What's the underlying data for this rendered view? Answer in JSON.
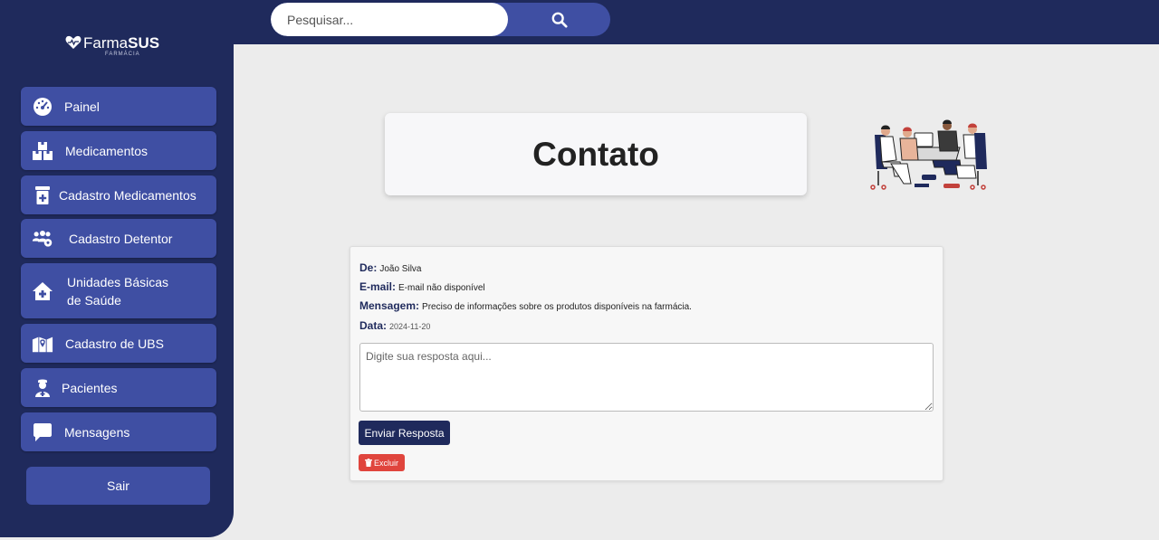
{
  "search": {
    "placeholder": "Pesquisar..."
  },
  "logo": {
    "brand_light": "Farma",
    "brand_bold": "SUS",
    "subtitle": "FARMÁCIA"
  },
  "sidebar": {
    "items": [
      {
        "label": "Painel",
        "icon": "gauge-icon"
      },
      {
        "label": "Medicamentos",
        "icon": "boxes-icon"
      },
      {
        "label": "Cadastro Medicamentos",
        "icon": "prescription-bottle-icon"
      },
      {
        "label": "Cadastro Detentor",
        "icon": "users-gear-icon"
      },
      {
        "label": "Unidades Básicas de Saúde",
        "icon": "house-medical-icon"
      },
      {
        "label": "Cadastro de UBS",
        "icon": "map-location-icon"
      },
      {
        "label": "Pacientes",
        "icon": "user-nurse-icon"
      },
      {
        "label": "Mensagens",
        "icon": "message-icon"
      }
    ],
    "logout_label": "Sair"
  },
  "page": {
    "title": "Contato"
  },
  "message": {
    "from_label": "De:",
    "from_value": "João Silva",
    "email_label": "E-mail:",
    "email_value": "E-mail não disponível",
    "message_label": "Mensagem:",
    "message_value": "Preciso de informações sobre os produtos disponíveis na farmácia.",
    "date_label": "Data:",
    "date_value": "2024-11-20",
    "reply_placeholder": "Digite sua resposta aqui...",
    "send_label": "Enviar Resposta",
    "delete_label": "Excluir"
  },
  "colors": {
    "navy": "#1f2a5c",
    "accent": "#3f4fa3",
    "danger": "#e0453d",
    "background": "#ececec"
  }
}
